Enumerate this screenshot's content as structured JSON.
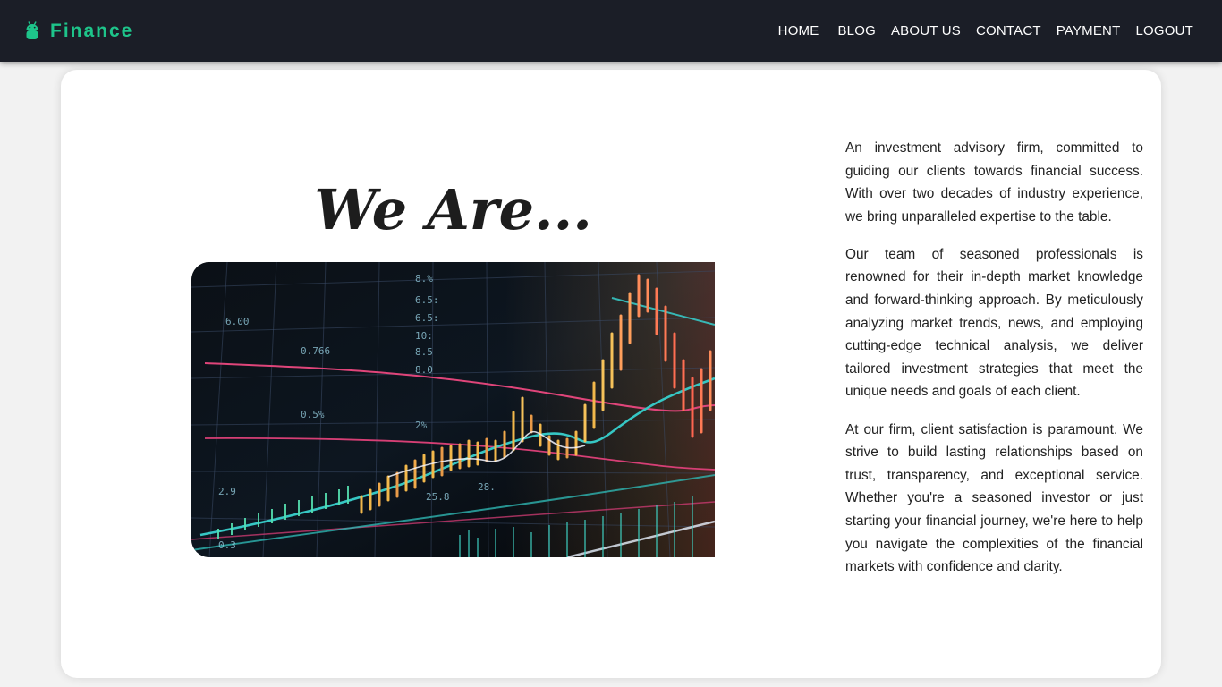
{
  "brand": {
    "name": "Finance",
    "icon": "android-icon",
    "color": "#1ec48a"
  },
  "nav": {
    "items": [
      {
        "label": "HOME"
      },
      {
        "label": "BLOG"
      },
      {
        "label": "ABOUT US"
      },
      {
        "label": "CONTACT"
      },
      {
        "label": "PAYMENT"
      },
      {
        "label": "LOGOUT"
      }
    ]
  },
  "about": {
    "heading": "We Are...",
    "image": "stock-market-chart-image",
    "paragraphs": [
      "An investment advisory firm, committed to guiding our clients towards financial success. With over two decades of industry experience, we bring unparalleled expertise to the table.",
      "Our team of seasoned professionals is renowned for their in-depth market knowledge and forward-thinking approach. By meticulously analyzing market trends, news, and employing cutting-edge technical analysis, we deliver tailored investment strategies that meet the unique needs and goals of each client.",
      "At our firm, client satisfaction is paramount. We strive to build lasting relationships based on trust, transparency, and exceptional service. Whether you're a seasoned investor or just starting your financial journey, we're here to help you navigate the complexities of the financial markets with confidence and clarity."
    ]
  },
  "colors": {
    "navbar_bg": "#1b1e27",
    "page_bg": "#f2f2f2",
    "card_bg": "#ffffff",
    "text": "#222222"
  }
}
